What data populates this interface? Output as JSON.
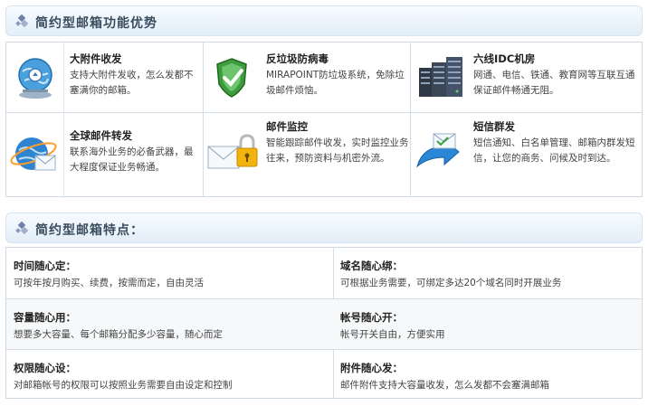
{
  "advantages_header": {
    "title": "简约型邮箱功能优势"
  },
  "advantages": [
    {
      "title": "大附件收发",
      "desc": "支持大附件发收，怎么发都不塞满你的邮箱。",
      "icon": "globe-upload-icon"
    },
    {
      "title": "反垃圾防病毒",
      "desc": "MIRAPOINT防垃圾系统，免除垃圾邮件烦恼。",
      "icon": "shield-icon"
    },
    {
      "title": "六线IDC机房",
      "desc": "网通、电信、铁通、教育网等互联互通保证邮件畅通无阻。",
      "icon": "server-rack-icon"
    },
    {
      "title": "全球邮件转发",
      "desc": "联系海外业务的必备武器，最大程度保证业务畅通。",
      "icon": "globe-mail-icon"
    },
    {
      "title": "邮件监控",
      "desc": "智能跟踪邮件收发，实时监控业务往来，预防资料与机密外流。",
      "icon": "mail-lock-icon"
    },
    {
      "title": "短信群发",
      "desc": "短信通知、白名单管理、邮箱内群发短信，让您的商务、问候及时到达。",
      "icon": "mail-arrow-icon"
    }
  ],
  "features_header": {
    "title": "简约型邮箱特点："
  },
  "features": [
    {
      "title": "时间随心定：",
      "desc": "可按年按月购买、续费，按需而定，自由灵活"
    },
    {
      "title": "域名随心绑：",
      "desc": "可根据业务需要，可绑定多达20个域名同时开展业务"
    },
    {
      "title": "容量随心用：",
      "desc": "想要多大容量、每个邮箱分配多少容量，随心而定"
    },
    {
      "title": "帐号随心开：",
      "desc": "帐号开关自由，方便实用"
    },
    {
      "title": "权限随心设：",
      "desc": "对邮箱帐号的权限可以按照业务需要自由设定和控制"
    },
    {
      "title": "附件随心发：",
      "desc": "邮件附件支持大容量收发，怎么发都不会塞满邮箱"
    }
  ]
}
